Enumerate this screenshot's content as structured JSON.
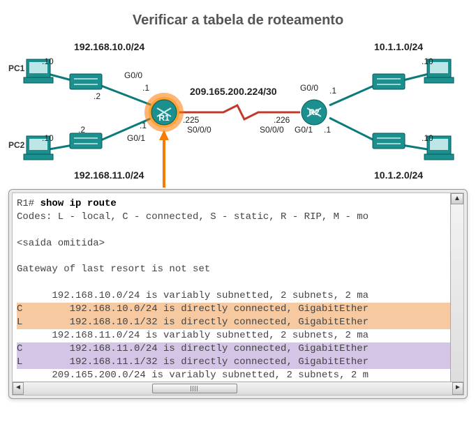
{
  "title": "Verificar a tabela de roteamento",
  "nets": {
    "top_left": "192.168.10.0/24",
    "bot_left": "192.168.11.0/24",
    "wan": "209.165.200.224/30",
    "top_right": "10.1.1.0/24",
    "bot_right": "10.1.2.0/24"
  },
  "pcs": {
    "pc1": "PC1",
    "pc2": "PC2"
  },
  "hosts": {
    "pc1_ip": ".10",
    "pc2_ip": ".10",
    "pc3_ip": ".10",
    "pc4_ip": ".10",
    "sw1_ip": ".2",
    "sw2_ip": ".2"
  },
  "r1": {
    "name": "R1",
    "g00": "G0/0",
    "g00_ip": ".1",
    "g01": "G0/1",
    "g01_ip": ".1",
    "s000": "S0/0/0",
    "s000_ip": ".225"
  },
  "r2": {
    "name": "R2",
    "g00": "G0/0",
    "g00_ip": ".1",
    "g01": "G0/1",
    "g01_ip": ".1",
    "s000": "S0/0/0",
    "s000_ip": ".226"
  },
  "term": {
    "prompt": "R1# ",
    "cmd": "show ip route",
    "codes": "Codes: L - local, C - connected, S - static, R - RIP, M - mo",
    "omitted": "<saída omitida>",
    "gw": "Gateway of last resort is not set",
    "l1": "      192.168.10.0/24 is variably subnetted, 2 subnets, 2 ma",
    "l2": "C        192.168.10.0/24 is directly connected, GigabitEther",
    "l3": "L        192.168.10.1/32 is directly connected, GigabitEther",
    "l4": "      192.168.11.0/24 is variably subnetted, 2 subnets, 2 ma",
    "l5": "C        192.168.11.0/24 is directly connected, GigabitEther",
    "l6": "L        192.168.11.1/32 is directly connected, GigabitEther",
    "l7": "      209.165.200.0/24 is variably subnetted, 2 subnets, 2 m"
  }
}
